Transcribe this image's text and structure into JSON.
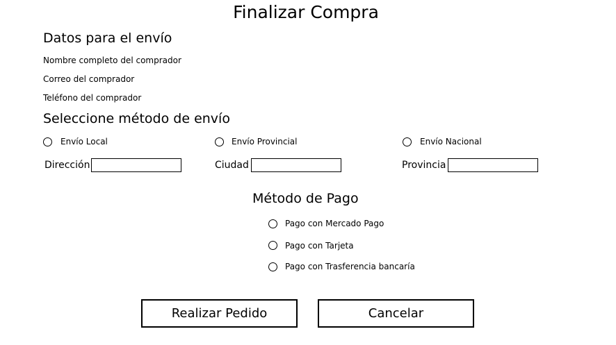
{
  "page_title": "Finalizar Compra",
  "shipping_data": {
    "heading": "Datos para el envío",
    "full_name_label": "Nombre completo del comprador",
    "email_label": "Correo del comprador",
    "phone_label": "Teléfono del comprador"
  },
  "shipping_method": {
    "heading": "Seleccione método de envío",
    "options": [
      {
        "label": "Envío Local",
        "field_label": "Dirección",
        "selected": false
      },
      {
        "label": "Envío Provincial",
        "field_label": "Ciudad",
        "selected": false
      },
      {
        "label": "Envío Nacional",
        "field_label": "Provincia",
        "selected": false
      }
    ]
  },
  "payment_method": {
    "heading": "Método de Pago",
    "options": [
      {
        "label": "Pago con Mercado Pago",
        "selected": false
      },
      {
        "label": "Pago con Tarjeta",
        "selected": false
      },
      {
        "label": "Pago con Trasferencia bancaría",
        "selected": false
      }
    ]
  },
  "buttons": {
    "submit_label": "Realizar Pedido",
    "cancel_label": "Cancelar"
  }
}
